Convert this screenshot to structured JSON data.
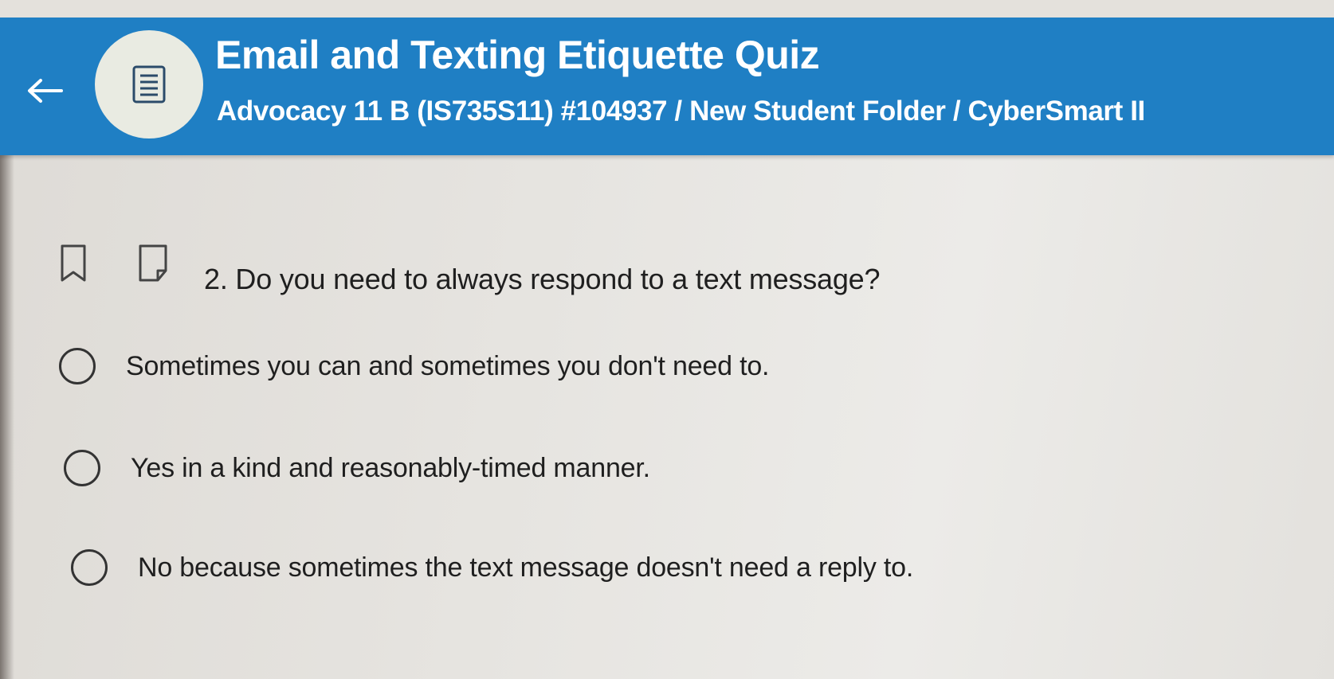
{
  "header": {
    "title": "Email and Texting Etiquette Quiz",
    "breadcrumb": "Advocacy 11 B (IS735S11) #104937 / New Student Folder / CyberSmart II",
    "back_icon": "arrow-left-icon",
    "avatar_icon": "document-list-icon"
  },
  "question": {
    "text": "2. Do you need to always respond to a text message?",
    "bookmark_icon": "bookmark-icon",
    "flag_icon": "flag-icon",
    "options": [
      {
        "label": "Sometimes you can and sometimes you don't need to.",
        "selected": false
      },
      {
        "label": "Yes in a kind and reasonably-timed manner.",
        "selected": false
      },
      {
        "label": "No because sometimes the text message doesn't need a reply to.",
        "selected": false
      }
    ]
  },
  "colors": {
    "header_bg": "#1f7fc4",
    "header_text": "#ffffff",
    "avatar_bg": "#e9ebe2",
    "page_bg": "#e6e4e0",
    "text": "#1f1f1f"
  }
}
